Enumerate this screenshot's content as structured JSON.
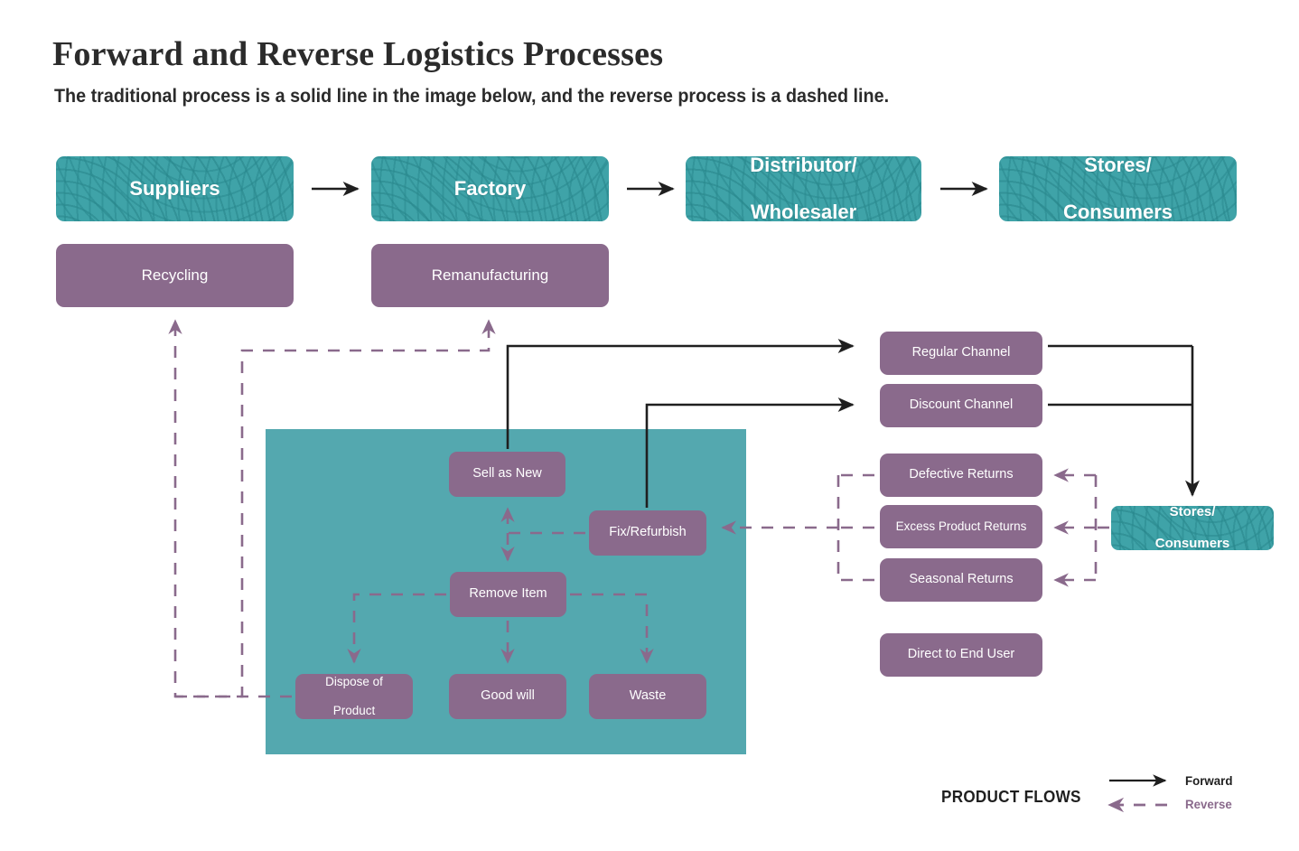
{
  "header": {
    "title": "Forward and Reverse Logistics Processes",
    "subtitle": "The traditional process is a solid line in the image below, and the reverse process is a dashed line."
  },
  "colors": {
    "teal_box": "#3fa3a8",
    "teal_panel": "#54a8af",
    "purple": "#8a6a8c",
    "forward_line": "#1f1f1f",
    "reverse_line": "#8a6a8c",
    "text_dark": "#2b2b2b",
    "text_light": "#ffffff"
  },
  "forward_chain": [
    {
      "label": "Suppliers"
    },
    {
      "label": "Factory"
    },
    {
      "label": "Distributor/\nWholesaler",
      "line1": "Distributor/",
      "line2": "Wholesaler"
    },
    {
      "label": "Stores/\nConsumers",
      "line1": "Stores/",
      "line2": "Consumers"
    }
  ],
  "recovery_boxes": [
    {
      "label": "Recycling"
    },
    {
      "label": "Remanufacturing"
    }
  ],
  "channels": [
    {
      "label": "Regular Channel"
    },
    {
      "label": "Discount Channel"
    }
  ],
  "returns": [
    {
      "label": "Defective Returns"
    },
    {
      "label": "Excess Product Returns"
    },
    {
      "label": "Seasonal Returns"
    }
  ],
  "direct": {
    "label": "Direct to End User"
  },
  "stores_return": {
    "line1": "Stores/",
    "line2": "Consumers"
  },
  "disposition_panel": {
    "nodes": [
      {
        "key": "sell_as_new",
        "label": "Sell as New"
      },
      {
        "key": "fix_refurbish",
        "label": "Fix/Refurbish"
      },
      {
        "key": "remove_item",
        "label": "Remove Item"
      },
      {
        "key": "dispose_of_product",
        "line1": "Dispose of",
        "line2": "Product"
      },
      {
        "key": "good_will",
        "label": "Good will"
      },
      {
        "key": "waste",
        "label": "Waste"
      }
    ]
  },
  "legend": {
    "title": "PRODUCT FLOWS",
    "forward": "Forward",
    "reverse": "Reverse"
  }
}
